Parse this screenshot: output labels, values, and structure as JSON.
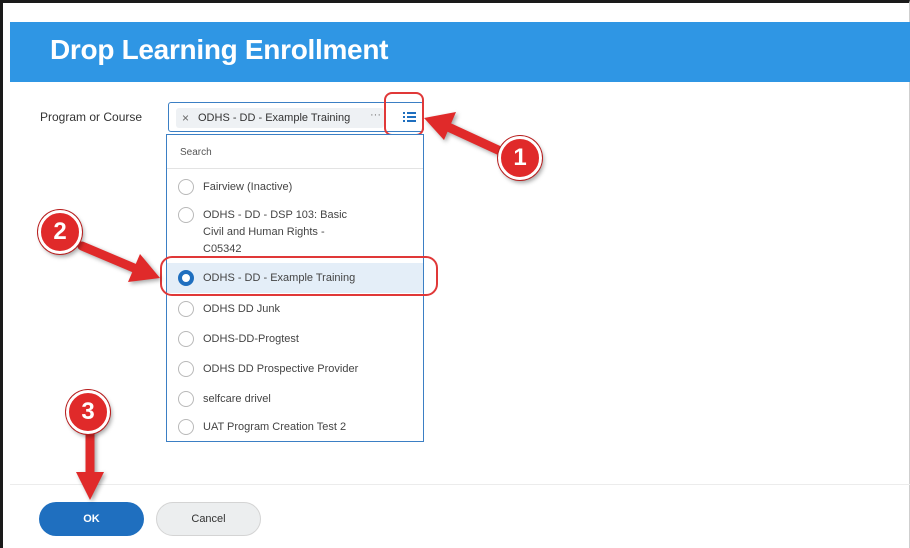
{
  "header": {
    "title": "Drop Learning Enrollment"
  },
  "form": {
    "field_label": "Program or Course",
    "selected_chip": "ODHS - DD - Example Training",
    "chip_remove": "×",
    "chip_more": "···"
  },
  "dropdown": {
    "search_placeholder": "Search",
    "options": [
      {
        "label": "Fairview (Inactive)"
      },
      {
        "label_lines": [
          "ODHS - DD - DSP 103: Basic",
          "Civil and Human Rights -",
          "C05342"
        ]
      },
      {
        "label": "ODHS - DD - Example Training",
        "selected": true
      },
      {
        "label": "ODHS DD Junk"
      },
      {
        "label": "ODHS-DD-Progtest"
      },
      {
        "label": "ODHS DD Prospective Provider"
      },
      {
        "label": "selfcare drivel"
      },
      {
        "label": "UAT Program Creation Test 2"
      }
    ]
  },
  "footer": {
    "ok_label": "OK",
    "cancel_label": "Cancel"
  },
  "annotations": {
    "step1": "1",
    "step2": "2",
    "step3": "3"
  },
  "colors": {
    "header": "#2f96e4",
    "primary": "#1f6fbf",
    "annotation": "#e02a2a",
    "selected_row": "#e4eef8"
  },
  "icons": {
    "list": "list-icon",
    "remove": "close-icon"
  }
}
